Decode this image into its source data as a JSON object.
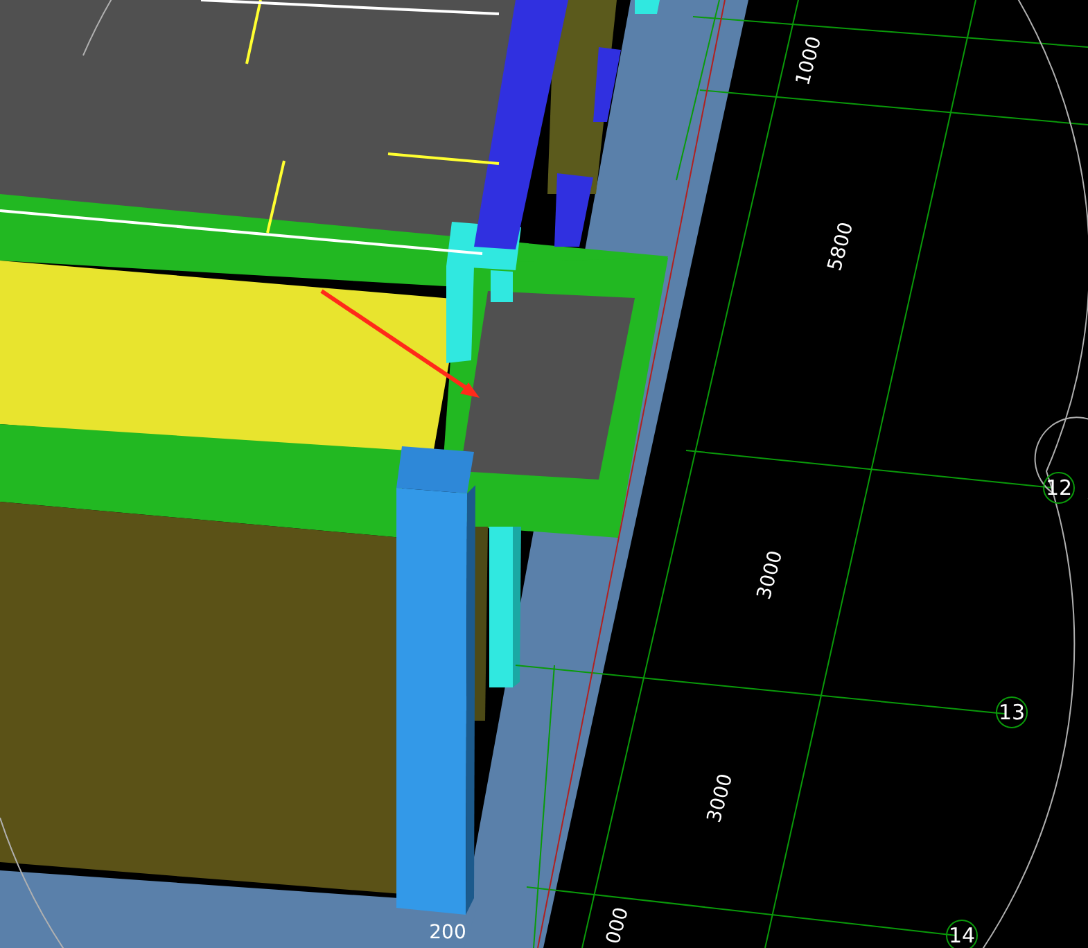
{
  "viewport": {
    "dimension_labels": [
      {
        "text": "1000"
      },
      {
        "text": "5800"
      },
      {
        "text": "3000"
      },
      {
        "text": "3000"
      },
      {
        "text": "200"
      },
      {
        "text": "000"
      }
    ],
    "grid_axes": [
      {
        "label": "12"
      },
      {
        "label": "13"
      },
      {
        "label": "14"
      }
    ]
  }
}
